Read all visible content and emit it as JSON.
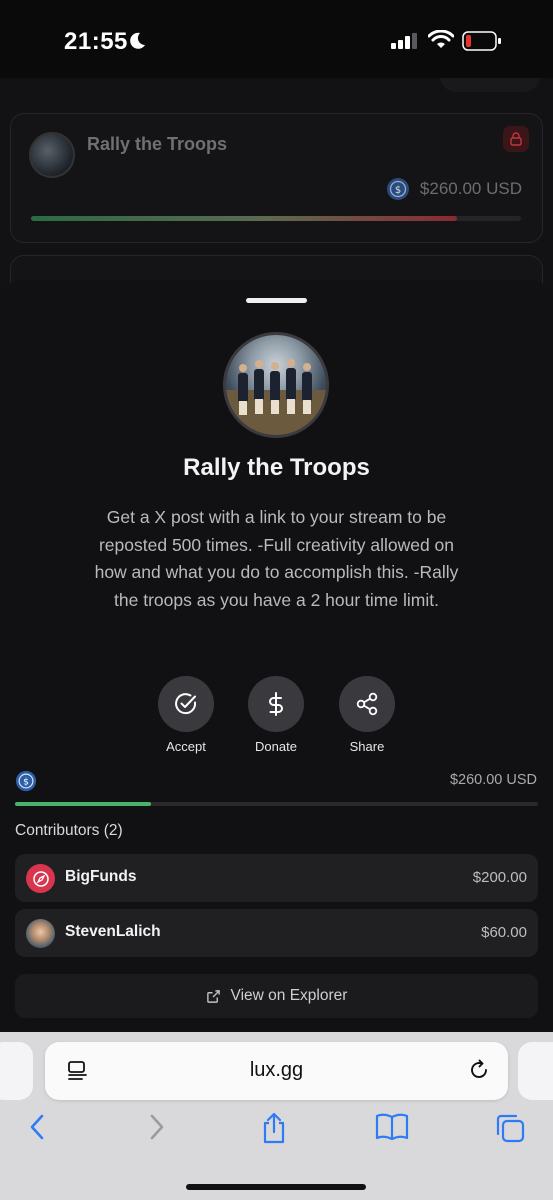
{
  "status_bar": {
    "time": "21:55",
    "icons": [
      "moon-icon",
      "signal-icon",
      "wifi-icon",
      "battery-low-icon"
    ]
  },
  "background_card": {
    "title": "Rally the Troops",
    "amount": "$260.00 USD",
    "progress": 0.87,
    "progress_colors": [
      "#2c6a46",
      "#8a2a33"
    ],
    "icons": [
      "lock-icon",
      "usdc-icon"
    ]
  },
  "sheet": {
    "title": "Rally the Troops",
    "description": "Get a X post with a link to your stream to be reposted 500 times. -Full creativity allowed on how and what you do to accomplish this. -Rally the troops as you have a 2 hour time limit.",
    "actions": [
      {
        "label": "Accept",
        "icon": "check-circle-icon"
      },
      {
        "label": "Donate",
        "icon": "dollar-icon"
      },
      {
        "label": "Share",
        "icon": "share-icon"
      }
    ],
    "total_amount": "$260.00 USD",
    "progress": 0.26,
    "progress_color": "#48b36b",
    "contributors_heading": "Contributors (2)",
    "contributors": [
      {
        "name": "BigFunds",
        "amount": "$200.00",
        "avatar_color": "#d8364f"
      },
      {
        "name": "StevenLalich",
        "amount": "$60.00"
      }
    ],
    "explorer_label": "View on Explorer"
  },
  "browser": {
    "url": "lux.gg",
    "toolbar_icons": [
      "back-icon",
      "forward-icon",
      "share-icon",
      "bookmarks-icon",
      "tabs-icon"
    ]
  }
}
